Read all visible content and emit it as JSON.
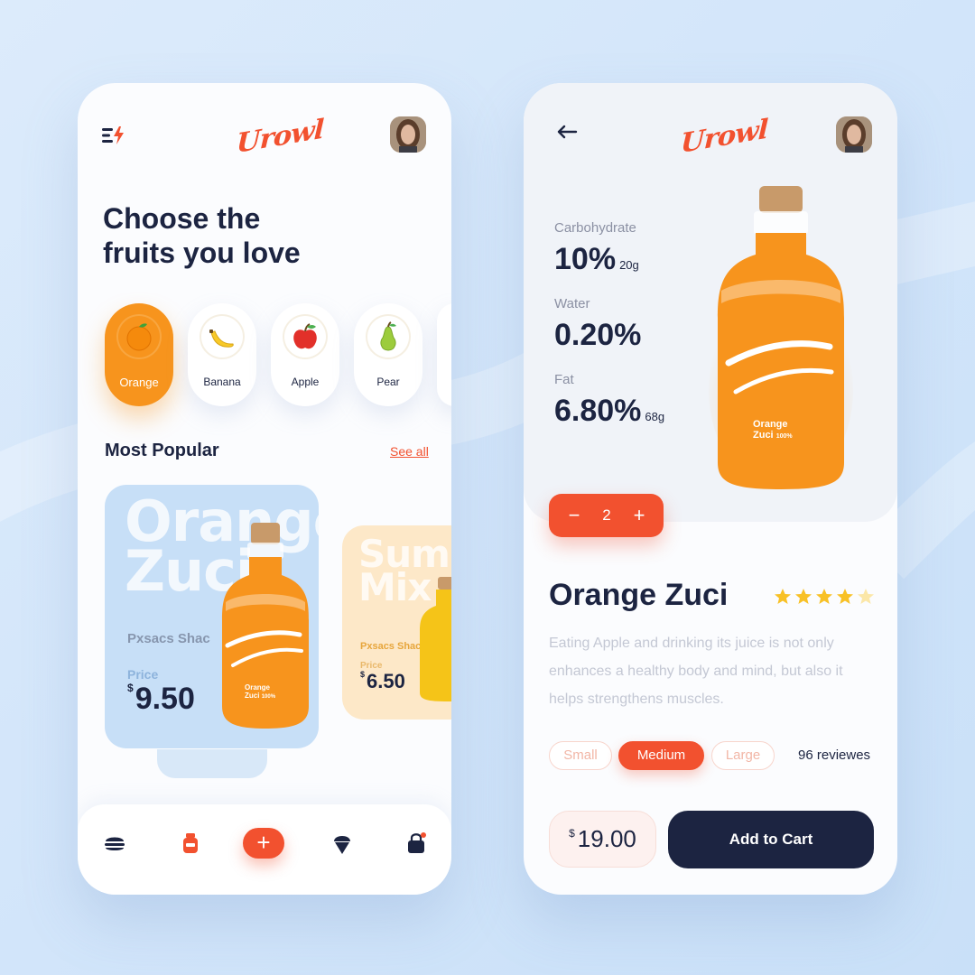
{
  "colors": {
    "accent": "#f2512f",
    "orange": "#f7941d",
    "navy": "#1c2441",
    "muted": "#8b90a3"
  },
  "brand": {
    "logo_text": "Urowl"
  },
  "home": {
    "headline_line1": "Choose the",
    "headline_line2": "fruits you love",
    "categories": [
      {
        "label": "Orange",
        "icon": "orange-icon",
        "active": true
      },
      {
        "label": "Banana",
        "icon": "banana-icon",
        "active": false
      },
      {
        "label": "Apple",
        "icon": "apple-icon",
        "active": false
      },
      {
        "label": "Pear",
        "icon": "pear-icon",
        "active": false
      }
    ],
    "section_title": "Most Popular",
    "see_all": "See all",
    "products": [
      {
        "big_line1": "Orange",
        "big_line2": "Zuci",
        "subtitle": "Pxsacs Shac",
        "price_label": "Price",
        "currency": "$",
        "price": "9.50",
        "bottle_line1": "Orange",
        "bottle_line2": "Zuci",
        "bottle_pct": "100%"
      },
      {
        "big_line1": "Summ",
        "big_line2": "Mix",
        "subtitle": "Pxsacs Shac",
        "price_label": "Price",
        "currency": "$",
        "price": "6.50"
      }
    ],
    "nav": [
      "burger-icon",
      "jar-icon",
      "plus-icon",
      "ice-cream-icon",
      "bag-icon"
    ],
    "fab_label": "+"
  },
  "detail": {
    "nutrition": [
      {
        "label": "Carbohydrate",
        "value": "10%",
        "unit": "20g"
      },
      {
        "label": "Water",
        "value": "0.20%",
        "unit": ""
      },
      {
        "label": "Fat",
        "value": "6.80%",
        "unit": "68g"
      }
    ],
    "bottle_line1": "Orange",
    "bottle_line2": "Zuci",
    "bottle_pct": "100%",
    "quantity": "2",
    "minus": "−",
    "plus": "+",
    "name": "Orange Zuci",
    "rating": 4.5,
    "description": "Eating Apple and drinking its juice is not only enhances a healthy body and mind, but also it helps strengthens muscles.",
    "sizes": [
      {
        "label": "Small",
        "selected": false
      },
      {
        "label": "Medium",
        "selected": true
      },
      {
        "label": "Large",
        "selected": false
      }
    ],
    "reviews": "96 reviewes",
    "currency": "$",
    "price": "19.00",
    "cta": "Add to Cart"
  }
}
